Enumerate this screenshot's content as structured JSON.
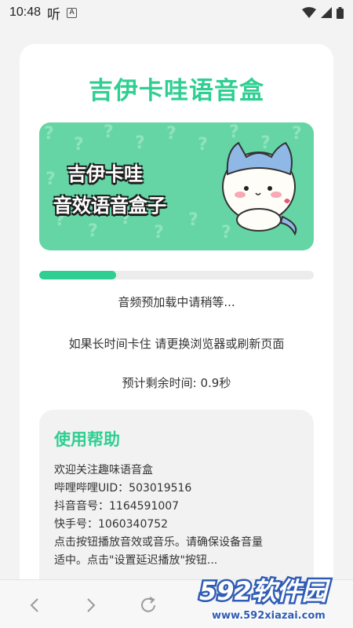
{
  "status": {
    "time": "10:48",
    "app_glyph": "听",
    "a_badge": "A"
  },
  "app": {
    "title": "吉伊卡哇语音盒",
    "banner_line1": "吉伊卡哇",
    "banner_line2": "音效语音盒子",
    "progress_percent": 28,
    "loading_text": "音频预加载中请稍等...",
    "tip_text": "如果长时间卡住 请更换浏览器或刷新页面",
    "remaining_text": "预计剩余时间: 0.9秒"
  },
  "help": {
    "title": "使用帮助",
    "lines": [
      "欢迎关注趣味语音盒",
      "哔哩哔哩UID：503019516",
      "抖音音号：1164591007",
      "快手号：1060340752",
      "点击按钮播放音效或音乐。请确保设备音量",
      "适中。点击\"设置延迟播放\"按钮..."
    ]
  },
  "watermark": {
    "brand": "592软件园",
    "url": "www.592xiazai.com"
  },
  "colors": {
    "accent": "#2ecf91",
    "banner": "#65d5a5"
  }
}
